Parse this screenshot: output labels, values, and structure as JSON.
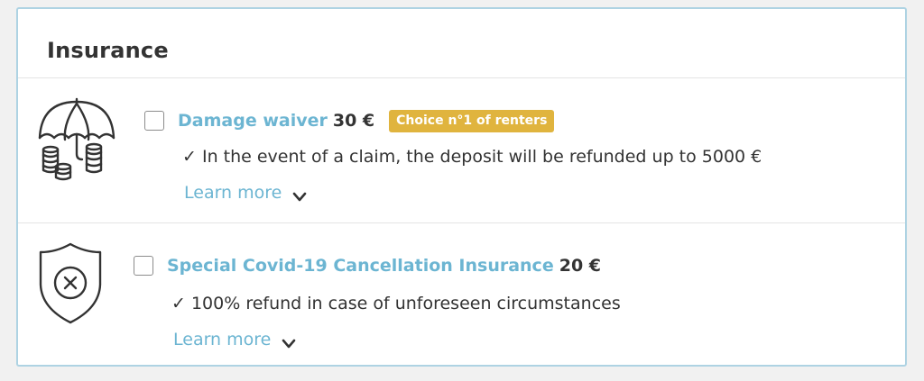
{
  "section": {
    "title": "Insurance"
  },
  "options": [
    {
      "icon": "umbrella-coins-icon",
      "name": "Damage waiver",
      "price": "30 €",
      "badge": "Choice n°1 of renters",
      "benefit": "✓ In the event of a claim, the deposit will be refunded up to 5000 €",
      "learn_more": "Learn more",
      "checked": false
    },
    {
      "icon": "shield-x-icon",
      "name": "Special Covid-19 Cancellation Insurance",
      "price": "20 €",
      "benefit": "✓ 100% refund in case of unforeseen circumstances",
      "learn_more": "Learn more",
      "checked": false
    }
  ],
  "colors": {
    "accent": "#6cb5d2",
    "badge": "#e0b43e",
    "border": "#aed3e3",
    "text": "#333333"
  }
}
